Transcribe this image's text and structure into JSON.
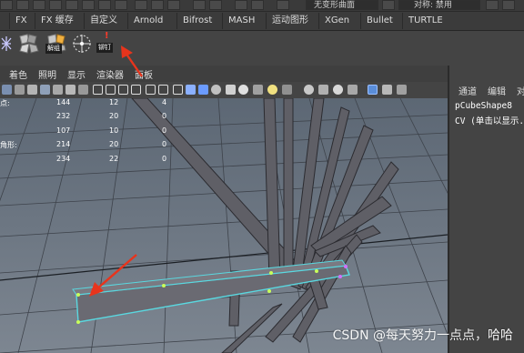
{
  "topbar": {
    "field_left": "无变形曲面",
    "field_right": "对称: 禁用"
  },
  "shelf_tabs": [
    "FX",
    "FX 缓存",
    "自定义",
    "Arnold",
    "Bifrost",
    "MASH",
    "运动图形",
    "XGen",
    "Bullet",
    "TURTLE"
  ],
  "shelf": {
    "unlock_label": "解组",
    "pin_label": "铆钉",
    "alert_glyph": "!"
  },
  "viewport_menu": [
    "着色",
    "照明",
    "显示",
    "渲染器",
    "面板"
  ],
  "hud": {
    "labels": [
      "点:",
      "",
      "",
      "角形:",
      ""
    ],
    "rows": [
      [
        "144",
        "12",
        "4"
      ],
      [
        "232",
        "20",
        "0"
      ],
      [
        "107",
        "10",
        "0"
      ],
      [
        "214",
        "20",
        "0"
      ],
      [
        "234",
        "22",
        "0"
      ]
    ]
  },
  "right_panel": {
    "channels_label": "通道",
    "edit_label": "编辑",
    "object_label": "对",
    "shape_name": "pCubeShape8",
    "cv_line": "CV (单击以显示..."
  },
  "watermark": "CSDN @每天努力一点点，哈哈",
  "colors": {
    "arrow": "#e8341c",
    "selection": "#5ad8e0",
    "highlight": "#c8ff5a",
    "object": "#5f5f66",
    "grid": "#3b3f46"
  }
}
